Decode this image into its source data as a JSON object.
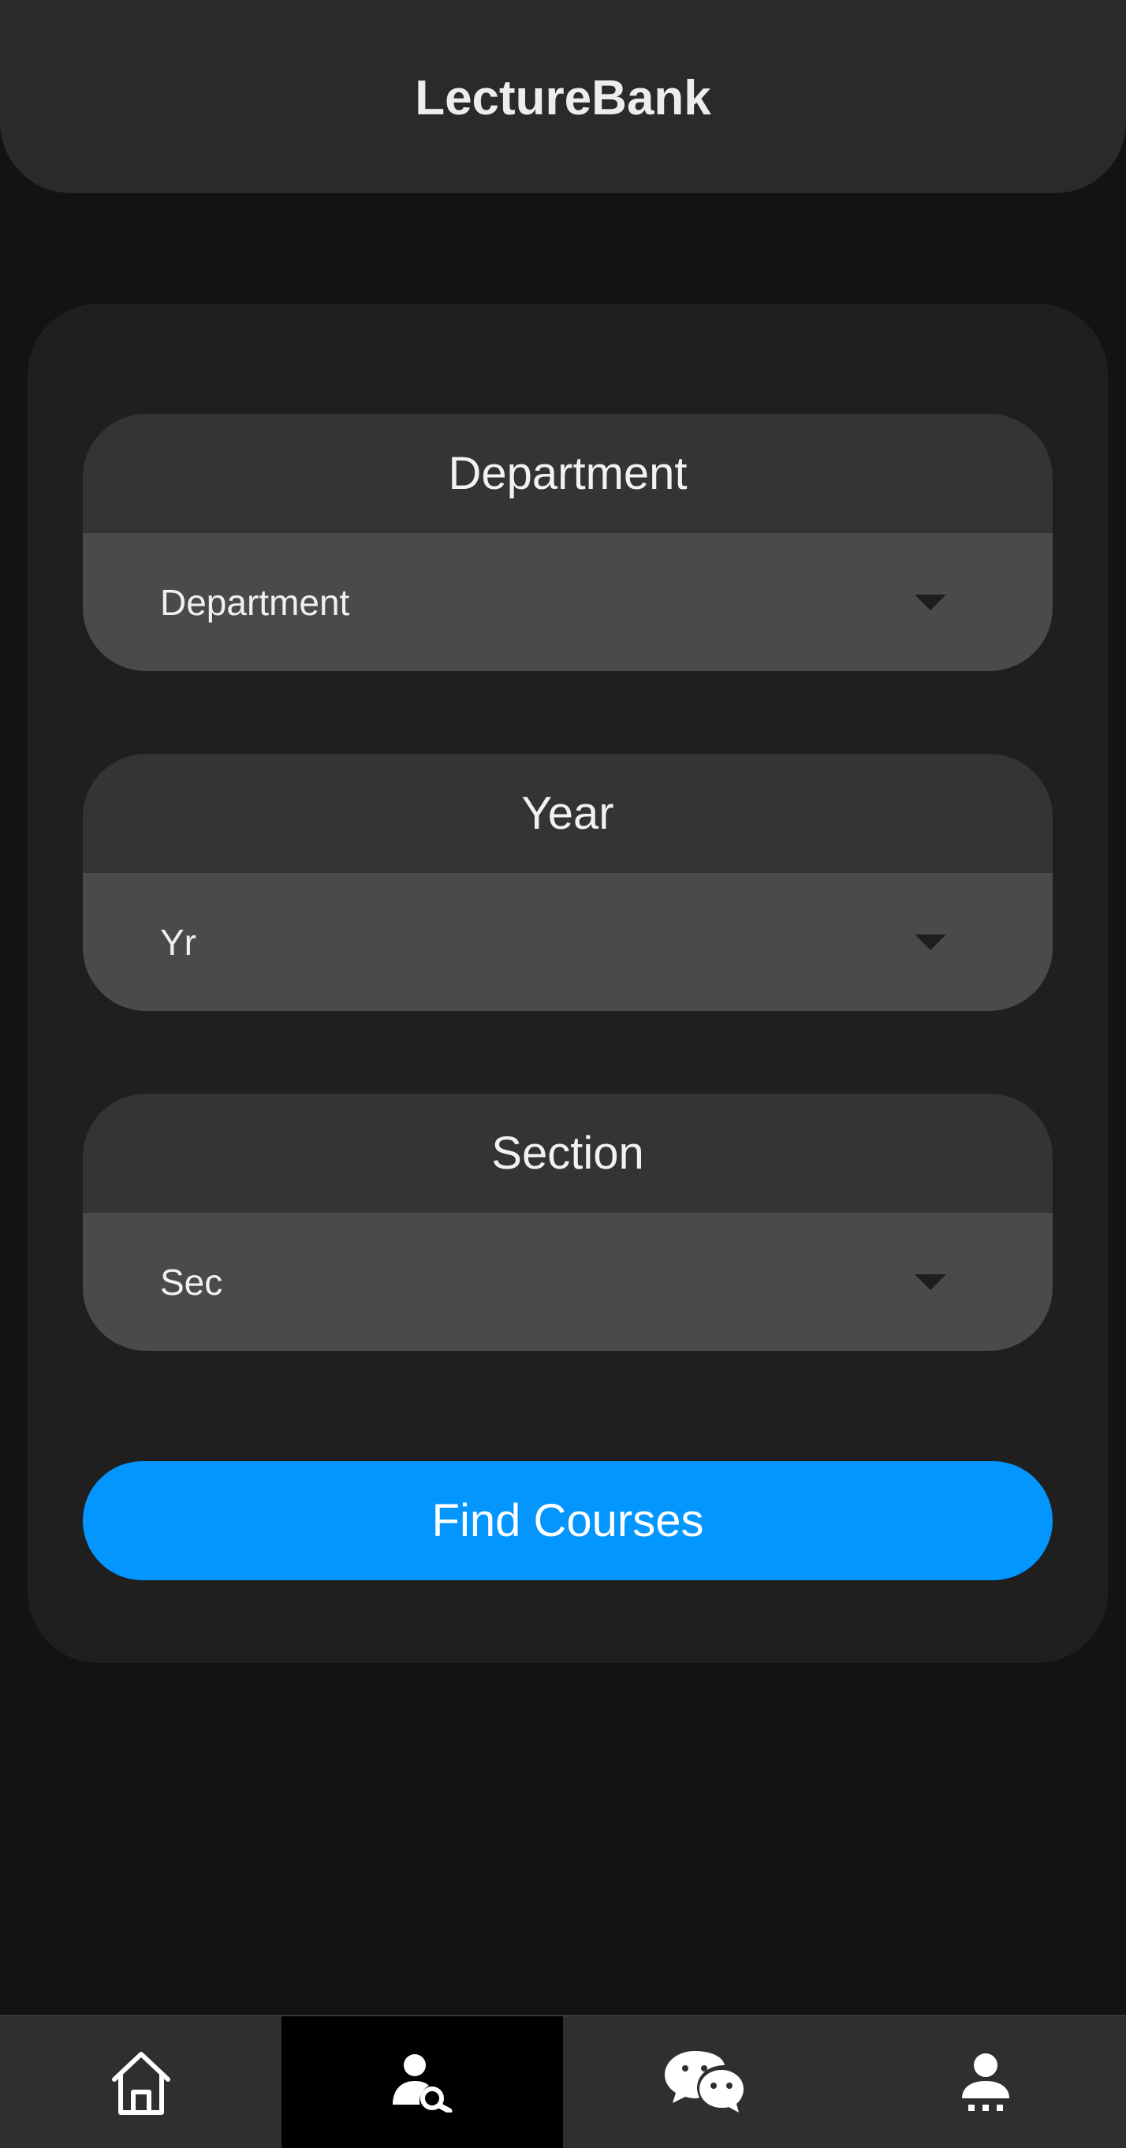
{
  "header": {
    "title": "LectureBank"
  },
  "form": {
    "department": {
      "label": "Department",
      "value": "Department"
    },
    "year": {
      "label": "Year",
      "value": "Yr"
    },
    "section": {
      "label": "Section",
      "value": "Sec"
    },
    "submit_label": "Find Courses"
  },
  "bottom_nav": {
    "items": [
      {
        "icon": "home-icon",
        "active": false
      },
      {
        "icon": "user-search-icon",
        "active": true
      },
      {
        "icon": "chat-icon",
        "active": false
      },
      {
        "icon": "profile-icon",
        "active": false
      }
    ]
  },
  "colors": {
    "accent": "#0396ff",
    "background": "#131313",
    "card": "#1f1f1f"
  }
}
